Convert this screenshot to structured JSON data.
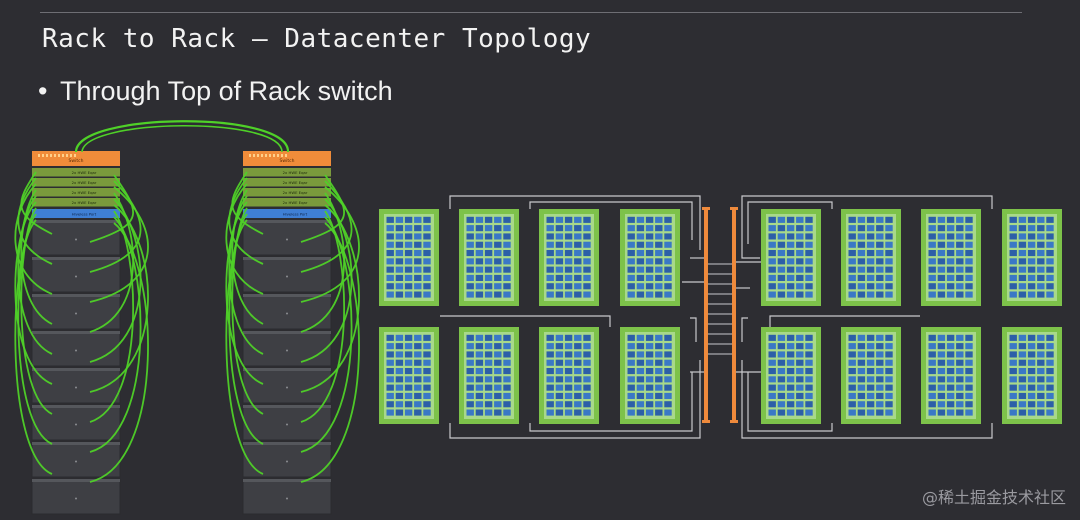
{
  "slide": {
    "title": "Rack to Rack – Datacenter Topology",
    "bullet": "Through Top of Rack switch",
    "bullet_marker": "•"
  },
  "racks": {
    "count": 2,
    "switch_label": "Switch",
    "leaf_labels": [
      "2x HWE Eqar",
      "2x HWE Eqar",
      "2x HWE Eqar",
      "2x HWE Eqar"
    ],
    "blue_label": "Hiveless Port",
    "chassis_per_rack": 8,
    "colors": {
      "switch": "#f08c3a",
      "leaf": "#7a9a3c",
      "blue": "#3f7fd4",
      "chassis": "#3e3f44",
      "cable": "#4fd128"
    }
  },
  "topology": {
    "left_tiles": 8,
    "right_tiles": 8,
    "central_lanes": 2,
    "rungs": 10,
    "colors": {
      "tile": "#7dc24a",
      "tile_inner": "#2f6db8",
      "spine": "#ef8a3c",
      "link": "#c8c8cc"
    }
  },
  "watermark": "@稀土掘金技术社区"
}
